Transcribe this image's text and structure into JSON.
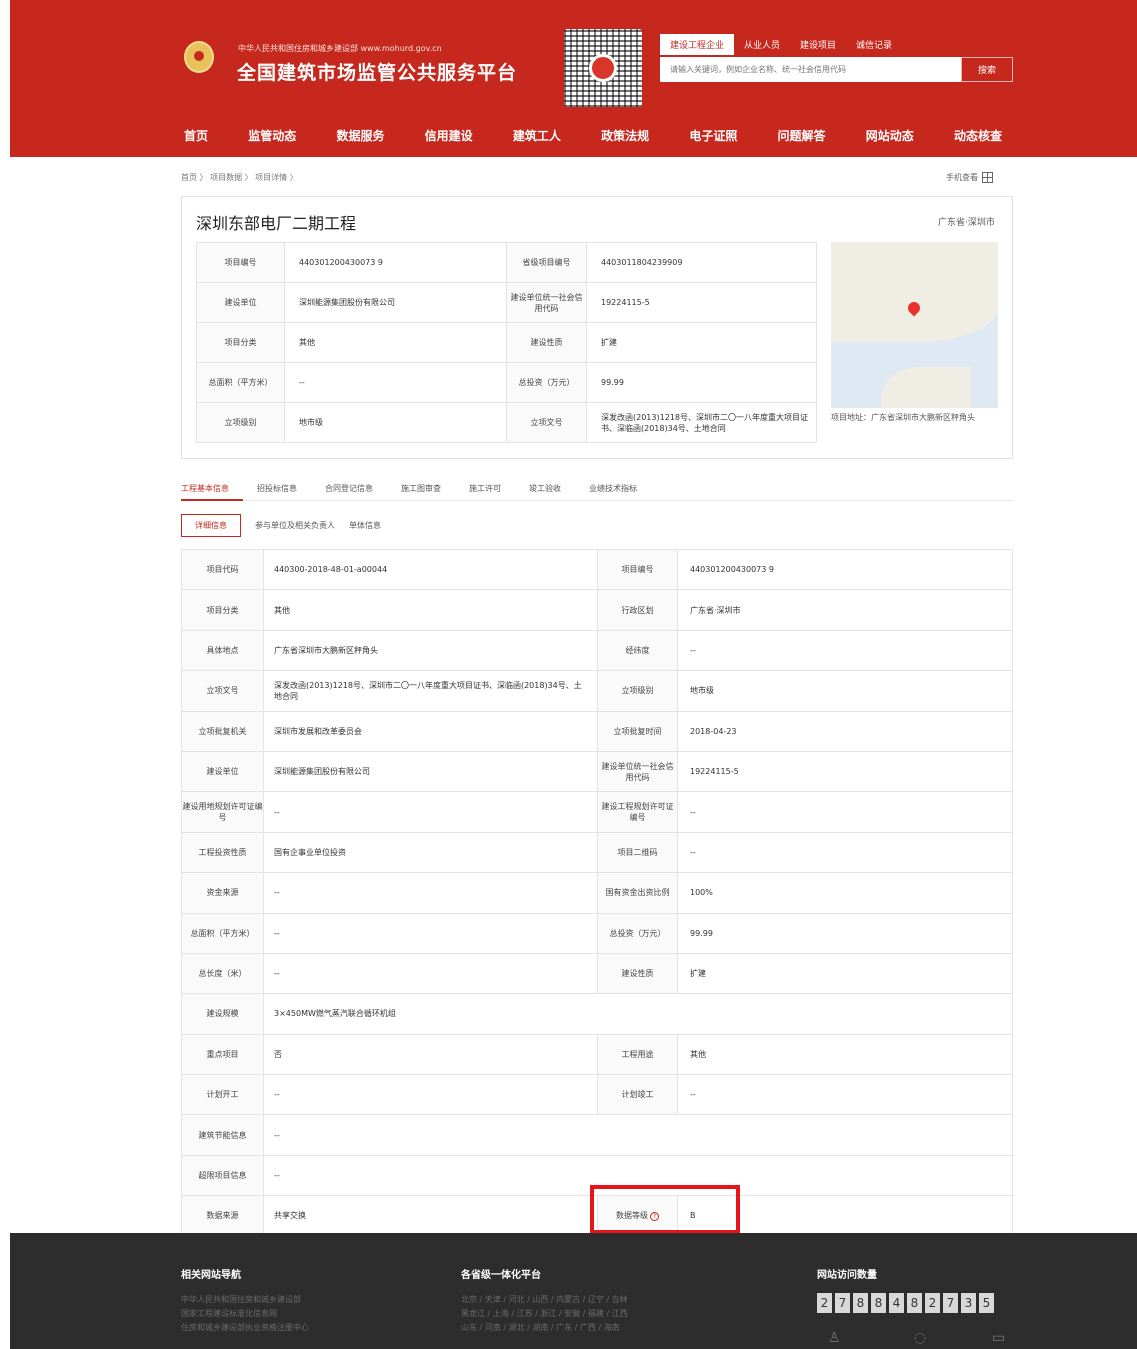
{
  "header": {
    "ministry": "中华人民共和国住房和城乡建设部  www.mohurd.gov.cn",
    "site_title": "全国建筑市场监管公共服务平台",
    "search_tabs": [
      "建设工程企业",
      "从业人员",
      "建设项目",
      "诚信记录"
    ],
    "search_placeholder": "请输入关键词，例如企业名称、统一社会信用代码",
    "search_button": "搜索",
    "nav": [
      "首页",
      "监管动态",
      "数据服务",
      "信用建设",
      "建筑工人",
      "政策法规",
      "电子证照",
      "问题解答",
      "网站动态",
      "动态核查"
    ]
  },
  "breadcrumb": "首页  〉 项目数据  〉 项目详情  〉",
  "mobile_view": "手机查看",
  "project": {
    "title": "深圳东部电厂二期工程",
    "region": "广东省·深圳市",
    "summary": [
      {
        "l1": "项目编号",
        "v1": "440301200430073 9",
        "l2": "省级项目编号",
        "v2": "4403011804239909"
      },
      {
        "l1": "建设单位",
        "v1": "深圳能源集团股份有限公司",
        "l2": "建设单位统一社会信用代码",
        "v2": "19224115-5"
      },
      {
        "l1": "项目分类",
        "v1": "其他",
        "l2": "建设性质",
        "v2": "扩建"
      },
      {
        "l1": "总面积（平方米）",
        "v1": "--",
        "l2": "总投资（万元）",
        "v2": "99.99"
      },
      {
        "l1": "立项级别",
        "v1": "地市级",
        "l2": "立项文号",
        "v2": "深发改函(2013)1218号、深圳市二〇一八年度重大项目证书、深临函(2018)34号、土地合同"
      }
    ],
    "map_address": "项目地址：广东省深圳市大鹏新区秤角头"
  },
  "tabs": [
    "工程基本信息",
    "招投标信息",
    "合同登记信息",
    "施工图审查",
    "施工许可",
    "竣工验收",
    "业绩技术指标"
  ],
  "subtabs": [
    "详细信息",
    "参与单位及相关负责人",
    "单体信息"
  ],
  "detail": [
    {
      "l1": "项目代码",
      "v1": "440300-2018-48-01-a00044",
      "l2": "项目编号",
      "v2": "440301200430073 9"
    },
    {
      "l1": "项目分类",
      "v1": "其他",
      "l2": "行政区划",
      "v2": "广东省·深圳市"
    },
    {
      "l1": "具体地点",
      "v1": "广东省深圳市大鹏新区秤角头",
      "l2": "经纬度",
      "v2": "--"
    },
    {
      "l1": "立项文号",
      "v1": "深发改函(2013)1218号、深圳市二〇一八年度重大项目证书、深临函(2018)34号、土地合同",
      "l2": "立项级别",
      "v2": "地市级"
    },
    {
      "l1": "立项批复机关",
      "v1": "深圳市发展和改革委员会",
      "l2": "立项批复时间",
      "v2": "2018-04-23"
    },
    {
      "l1": "建设单位",
      "v1": "深圳能源集团股份有限公司",
      "l2": "建设单位统一社会信用代码",
      "v2": "19224115-5"
    },
    {
      "l1": "建设用地规划许可证编号",
      "v1": "--",
      "l2": "建设工程规划许可证编号",
      "v2": "--"
    },
    {
      "l1": "工程投资性质",
      "v1": "国有企事业单位投资",
      "l2": "项目二维码",
      "v2": "--"
    },
    {
      "l1": "资金来源",
      "v1": "--",
      "l2": "国有资金出资比例",
      "v2": "100%"
    },
    {
      "l1": "总面积（平方米）",
      "v1": "--",
      "l2": "总投资（万元）",
      "v2": "99.99"
    },
    {
      "l1": "总长度（米）",
      "v1": "--",
      "l2": "建设性质",
      "v2": "扩建"
    }
  ],
  "detail_full": [
    {
      "l": "建设规模",
      "v": "3×450MW燃气蒸汽联合循环机组"
    }
  ],
  "detail2": [
    {
      "l1": "重点项目",
      "v1": "否",
      "l2": "工程用途",
      "v2": "其他"
    },
    {
      "l1": "计划开工",
      "v1": "--",
      "l2": "计划竣工",
      "v2": "--"
    }
  ],
  "detail_full2": [
    {
      "l": "建筑节能信息",
      "v": "--"
    },
    {
      "l": "超限项目信息",
      "v": "--"
    }
  ],
  "last_row": {
    "l1": "数据来源",
    "v1": "共享交换",
    "l2": "数据等级",
    "v2": "B"
  },
  "footer": {
    "col1_title": "相关网站导航",
    "col1_links": [
      "中华人民共和国住房和城乡建设部",
      "国家工程建设标准化信息网",
      "住房和城乡建设部执业资格注册中心"
    ],
    "col2_title": "各省级一体化平台",
    "col2_links": [
      "北京 / 天津 / 河北 / 山西 / 内蒙古 / 辽宁 / 吉林",
      "黑龙江 / 上海 / 江苏 / 浙江 / 安徽 / 福建 / 江西",
      "山东 / 河南 / 湖北 / 湖南 / 广东 / 广西 / 海南"
    ],
    "col3_title": "网站访问数量",
    "counter": [
      "2",
      "7",
      "8",
      "8",
      "4",
      "8",
      "2",
      "7",
      "3",
      "5"
    ]
  }
}
